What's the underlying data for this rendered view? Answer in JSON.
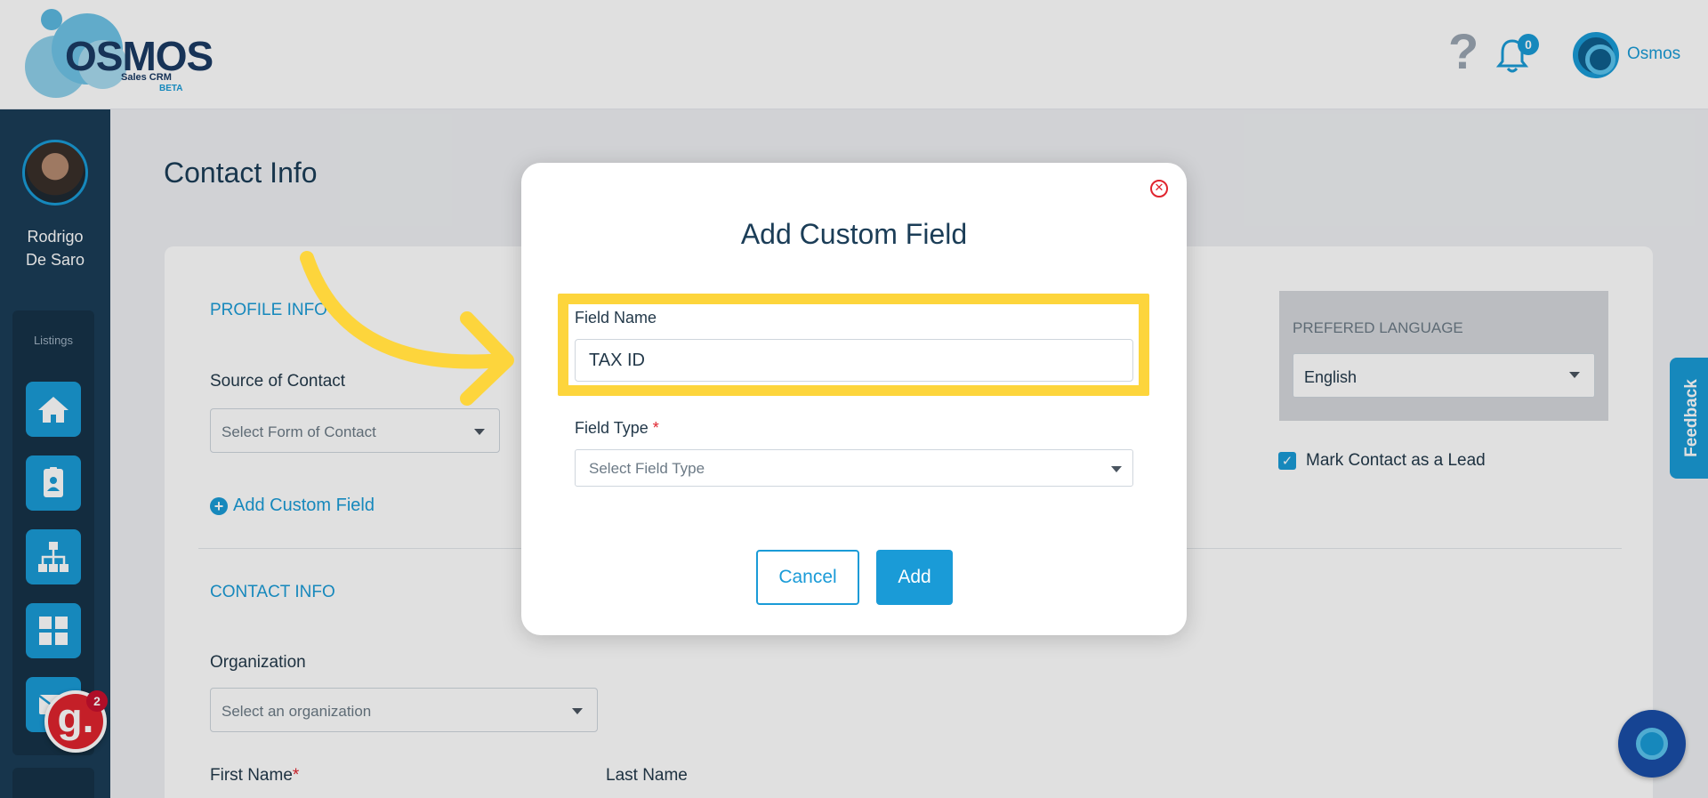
{
  "header": {
    "logo_text": "OSMOS",
    "logo_sub": "Sales CRM",
    "logo_beta": "BETA",
    "help_icon": "?",
    "notification_count": "0",
    "user_name": "Osmos"
  },
  "sidebar": {
    "user_name_line1": "Rodrigo",
    "user_name_line2": "De Saro",
    "listings_label": "Listings",
    "nav_icons": [
      "home-icon",
      "contact-card-icon",
      "org-chart-icon",
      "grid-icon",
      "mail-icon"
    ],
    "g_badge_letter": "g.",
    "g_badge_count": "2"
  },
  "page": {
    "title": "Contact Info",
    "profile_info_label": "PROFILE INFO",
    "source_label": "Source of Contact",
    "source_placeholder": "Select Form of Contact",
    "add_custom_field": "Add Custom Field",
    "contact_info_label": "CONTACT INFO",
    "organization_label": "Organization",
    "organization_placeholder": "Select an organization",
    "first_name_label": "First Name",
    "first_name_required": "*",
    "last_name_label": "Last Name",
    "language_label": "PREFERED LANGUAGE",
    "language_value": "English",
    "lead_checkbox_label": "Mark Contact as a Lead",
    "lead_checked": true
  },
  "feedback_tab": "Feedback",
  "modal": {
    "title": "Add Custom Field",
    "field_name_label": "Field Name",
    "field_name_value": "TAX ID",
    "field_type_label": "Field Type",
    "field_type_required": "*",
    "field_type_placeholder": "Select Field Type",
    "cancel_label": "Cancel",
    "add_label": "Add",
    "close_symbol": "✕"
  },
  "colors": {
    "accent": "#1a9bd7",
    "sidebar": "#1b3d57",
    "highlight": "#fdd53c",
    "required": "#e0242e"
  }
}
